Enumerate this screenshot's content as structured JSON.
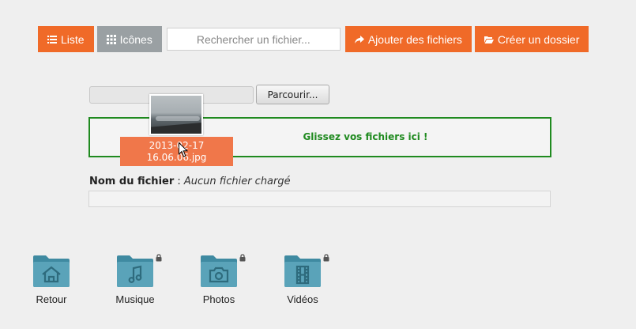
{
  "toolbar": {
    "list_label": "Liste",
    "icons_label": "Icônes",
    "search_placeholder": "Rechercher un fichier...",
    "add_files_label": "Ajouter des fichiers",
    "create_folder_label": "Créer un dossier",
    "list_icon": "list-icon",
    "grid_icon": "grid-icon",
    "share_icon": "share-arrow-icon",
    "folder_open_icon": "folder-open-icon"
  },
  "upload": {
    "browse_label": "Parcourir...",
    "dropzone_text": "Glissez vos fichiers ici !",
    "dragged_file_name": "2013-02-17 16.06.06.jpg",
    "file_name_label": "Nom du fichier",
    "file_name_separator": " : ",
    "file_name_value": "Aucun fichier chargé",
    "progress_percent": 0
  },
  "folders": [
    {
      "label": "Retour",
      "icon": "home-icon",
      "locked": false
    },
    {
      "label": "Musique",
      "icon": "music-note-icon",
      "locked": true
    },
    {
      "label": "Photos",
      "icon": "camera-icon",
      "locked": true
    },
    {
      "label": "Vidéos",
      "icon": "film-icon",
      "locked": true
    }
  ],
  "colors": {
    "accent_orange": "#f06a28",
    "view_button_gray": "#9aa0a3",
    "dropzone_green": "#1f8a1f",
    "folder_teal": "#4e9ab0",
    "background": "#efefef"
  }
}
